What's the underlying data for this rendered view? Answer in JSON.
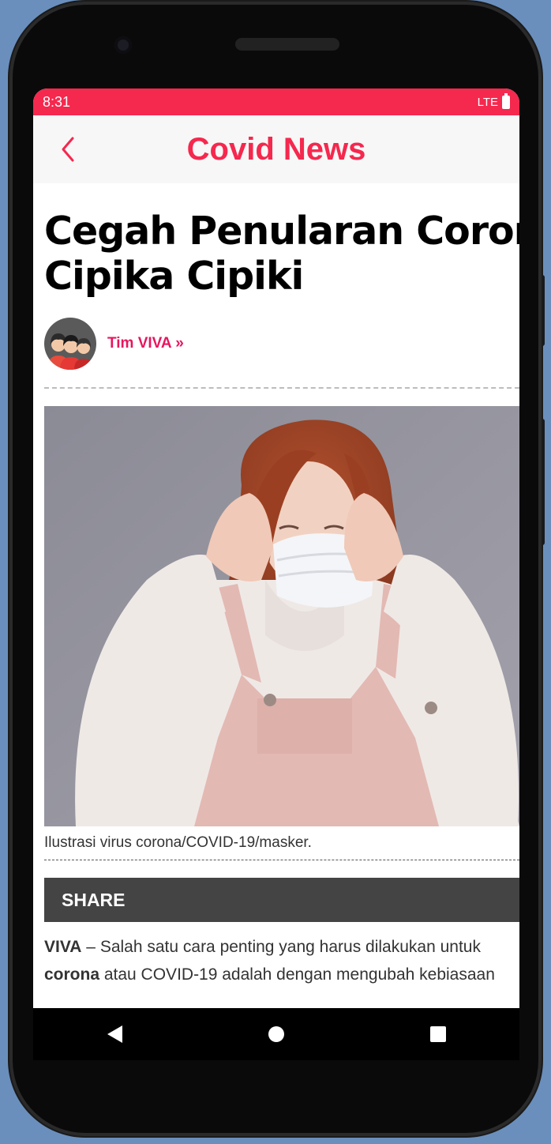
{
  "status_bar": {
    "time": "8:31",
    "network": "LTE"
  },
  "app_bar": {
    "title": "Covid News",
    "back_icon": "chevron-left-icon"
  },
  "article": {
    "headline_line1": "Cegah Penularan Corona,",
    "headline_line2": "Cipika Cipiki",
    "author": "Tim VIVA »",
    "image_caption": "Ilustrasi virus corona/COVID-19/masker.",
    "share_label": "SHARE",
    "body_line1_bold": "VIVA",
    "body_line1_rest": " – Salah satu cara penting yang harus dilakukan untuk",
    "body_line2_bold": "corona",
    "body_line2_rest": " atau COVID-19 adalah dengan mengubah kebiasaan"
  },
  "nav_bar": {
    "back": "triangle-back-icon",
    "home": "circle-home-icon",
    "recents": "square-recents-icon"
  },
  "colors": {
    "accent": "#f5284e",
    "author": "#e8155f",
    "share_bg": "#444444"
  }
}
